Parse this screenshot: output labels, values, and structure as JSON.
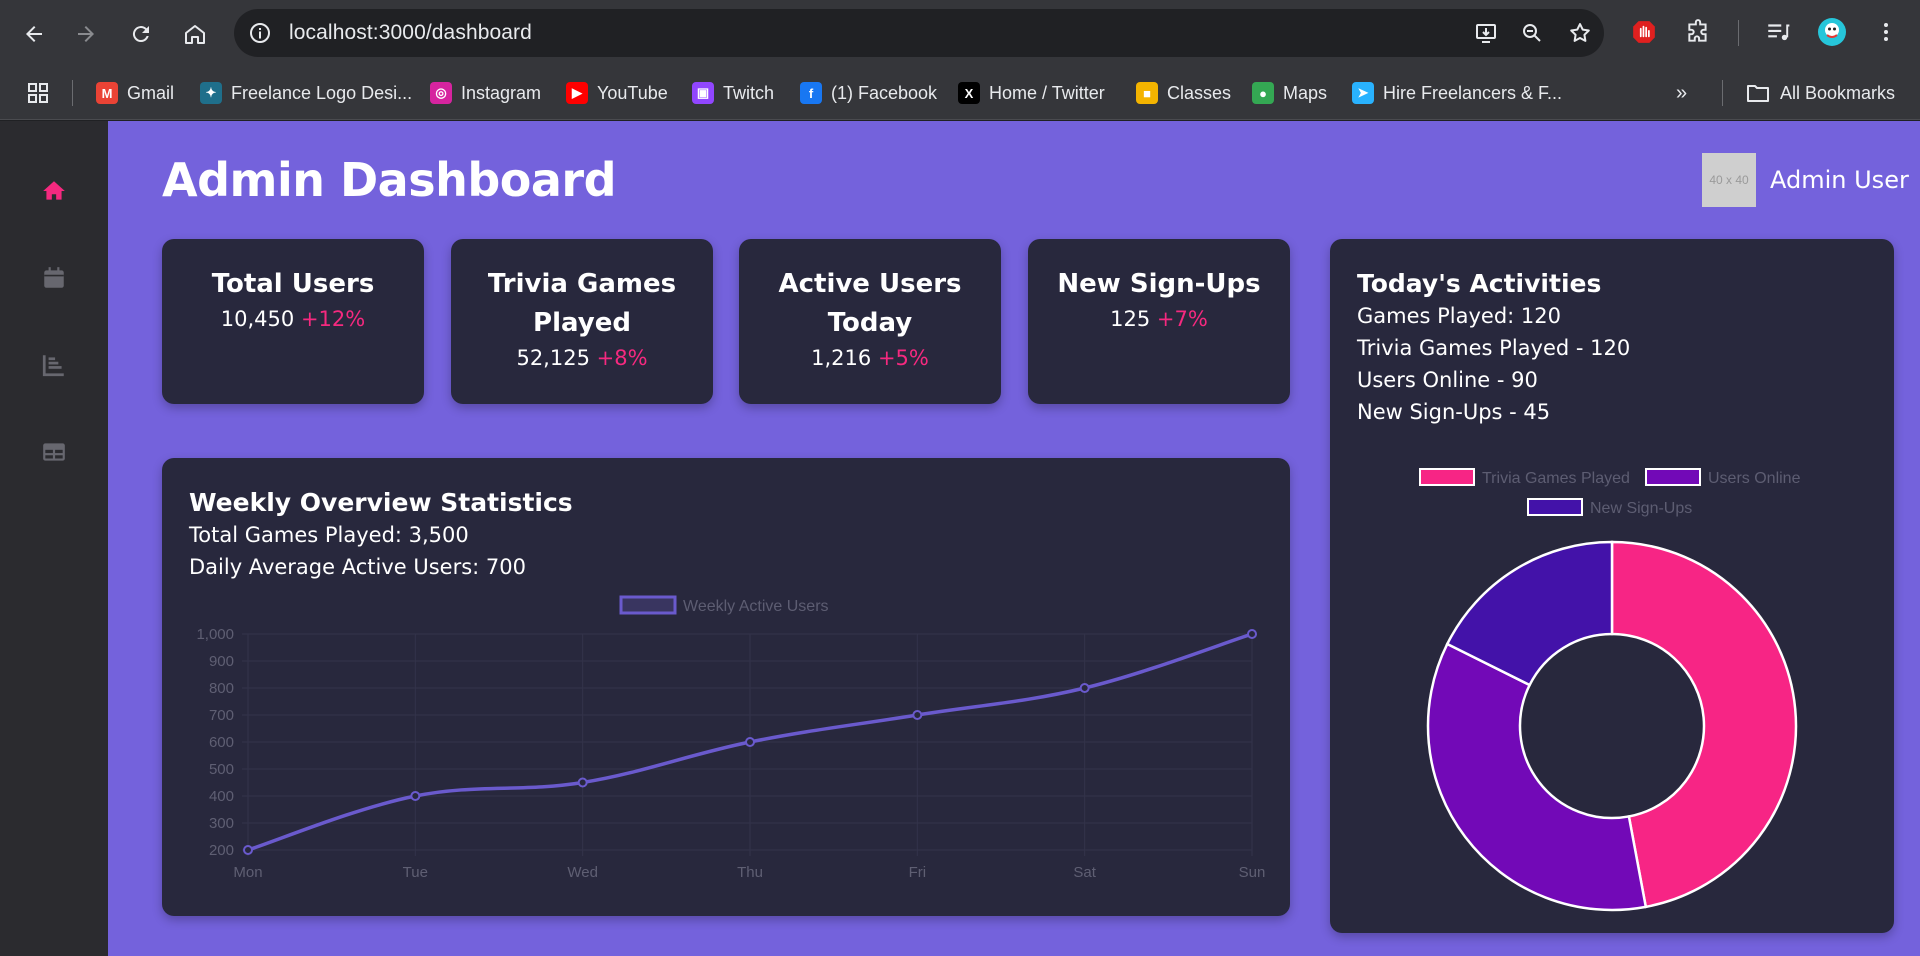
{
  "browser": {
    "url_host": "localhost",
    "url_path": ":3000/dashboard",
    "bookmarks": [
      {
        "label": "Gmail",
        "icon": "gmail-icon",
        "color": "#ea4335",
        "glyph": "M"
      },
      {
        "label": "Freelance Logo Desi...",
        "icon": "freelance-icon",
        "color": "#1f6f8b",
        "glyph": "✦"
      },
      {
        "label": "Instagram",
        "icon": "instagram-icon",
        "color": "#d6249f",
        "glyph": "◎"
      },
      {
        "label": "YouTube",
        "icon": "youtube-icon",
        "color": "#ff0000",
        "glyph": "▶"
      },
      {
        "label": "Twitch",
        "icon": "twitch-icon",
        "color": "#9146ff",
        "glyph": "▣"
      },
      {
        "label": "(1) Facebook",
        "icon": "facebook-icon",
        "color": "#1877f2",
        "glyph": "f"
      },
      {
        "label": "Home / Twitter",
        "icon": "x-icon",
        "color": "#000000",
        "glyph": "X"
      },
      {
        "label": "Classes",
        "icon": "classroom-icon",
        "color": "#f4b400",
        "glyph": "■"
      },
      {
        "label": "Maps",
        "icon": "maps-icon",
        "color": "#34a853",
        "glyph": "●"
      },
      {
        "label": "Hire Freelancers & F...",
        "icon": "freelancer-icon",
        "color": "#29b2fe",
        "glyph": "➤"
      }
    ],
    "all_bookmarks": "All Bookmarks"
  },
  "header": {
    "title": "Admin Dashboard",
    "avatar_text": "40 x 40",
    "user_name": "Admin User"
  },
  "stats": [
    {
      "label": "Total Users",
      "value": "10,450",
      "change": "+12%"
    },
    {
      "label": "Trivia Games Played",
      "value": "52,125",
      "change": "+8%"
    },
    {
      "label": "Active Users Today",
      "value": "1,216",
      "change": "+5%"
    },
    {
      "label": "New Sign-Ups",
      "value": "125",
      "change": "+7%"
    }
  ],
  "weekly": {
    "title": "Weekly Overview Statistics",
    "line1": "Total Games Played: 3,500",
    "line2": "Daily Average Active Users: 700"
  },
  "today": {
    "title": "Today's Activities",
    "lines": [
      "Games Played: 120",
      "Trivia Games Played - 120",
      "Users Online - 90",
      "New Sign-Ups - 45"
    ]
  },
  "colors": {
    "accent": "#f5297f",
    "background": "#7462dc",
    "card": "#28283d",
    "line": "#6a5acd"
  },
  "chart_data": [
    {
      "type": "line",
      "legend": [
        "Weekly Active Users"
      ],
      "categories": [
        "Mon",
        "Tue",
        "Wed",
        "Thu",
        "Fri",
        "Sat",
        "Sun"
      ],
      "series": [
        {
          "name": "Weekly Active Users",
          "values": [
            200,
            400,
            450,
            600,
            700,
            800,
            1000
          ]
        }
      ],
      "ylim": [
        200,
        1000
      ],
      "yticks": [
        "1,000",
        "900",
        "800",
        "700",
        "600",
        "500",
        "400",
        "300",
        "200"
      ],
      "grid": true,
      "legend_position": "top"
    },
    {
      "type": "pie",
      "donut": true,
      "labels": [
        "Trivia Games Played",
        "Users Online",
        "New Sign-Ups"
      ],
      "values": [
        120,
        90,
        45
      ],
      "colors": [
        "#f72585",
        "#7209b7",
        "#4312a9"
      ],
      "legend_position": "top"
    }
  ]
}
